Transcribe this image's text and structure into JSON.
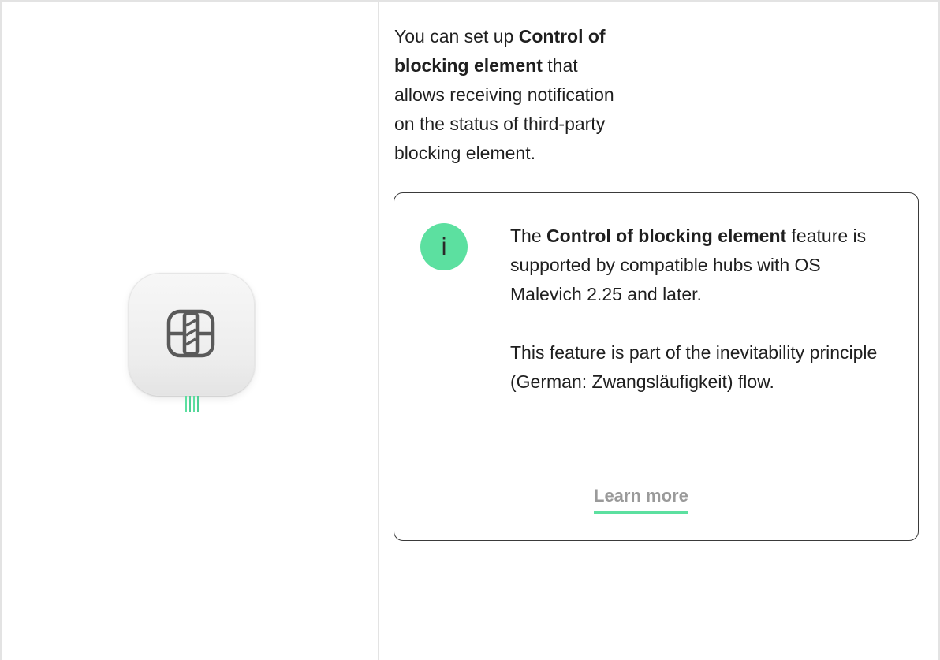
{
  "intro": {
    "before": "You can set up ",
    "bold": "Control of blocking element",
    "after": " that allows receiving notification on the status of third-party blocking element."
  },
  "note": {
    "icon": "info-icon",
    "icon_glyph": "i",
    "p1_before": "The ",
    "p1_bold": "Control of blocking element",
    "p1_after": " feature is supported by compatible hubs with OS Malevich 2.25 and later.",
    "p2": "This feature is part of the inevitability principle (German: Zwangsläufigkeit) flow.",
    "link_label": "Learn more"
  },
  "device": {
    "icon": "blocking-element-device-icon"
  },
  "colors": {
    "accent": "#5ce0a0",
    "border": "#e3e3e3",
    "text": "#1f1f1f",
    "link_text": "#9a9a9a"
  }
}
